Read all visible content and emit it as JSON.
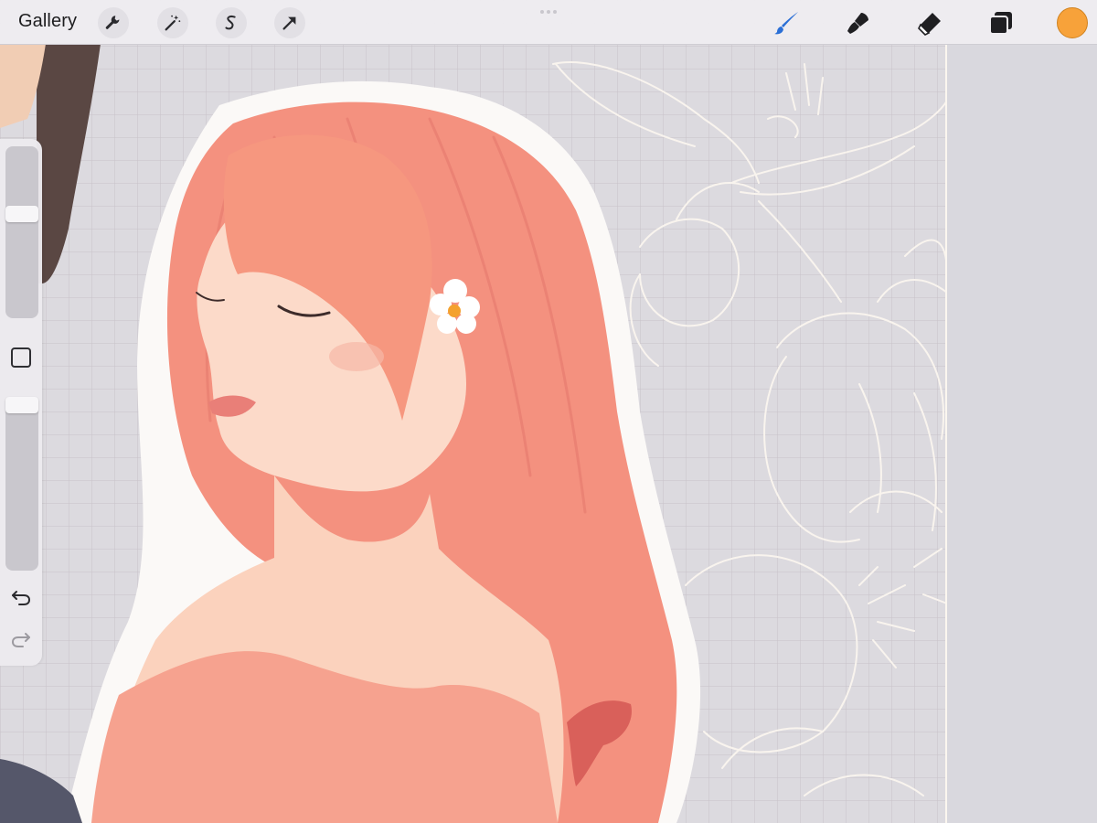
{
  "topbar": {
    "gallery_label": "Gallery",
    "left_tools": [
      "wrench-icon",
      "magic-wand-icon",
      "selection-icon",
      "transform-arrow-icon"
    ],
    "right_tools": [
      "brush-icon",
      "smudge-icon",
      "eraser-icon",
      "layers-icon"
    ],
    "active_tool": "brush-icon",
    "current_color": "#f7a23a"
  },
  "sidebar": {
    "brush_size_level": 0.62,
    "opacity_level": 1.0
  },
  "colors": {
    "brush_active": "#2b6fd6",
    "hair": "#f4917f",
    "skin": "#fbd6c4",
    "canvas": "#dcdadf",
    "lineart": "#fbf6ef"
  }
}
